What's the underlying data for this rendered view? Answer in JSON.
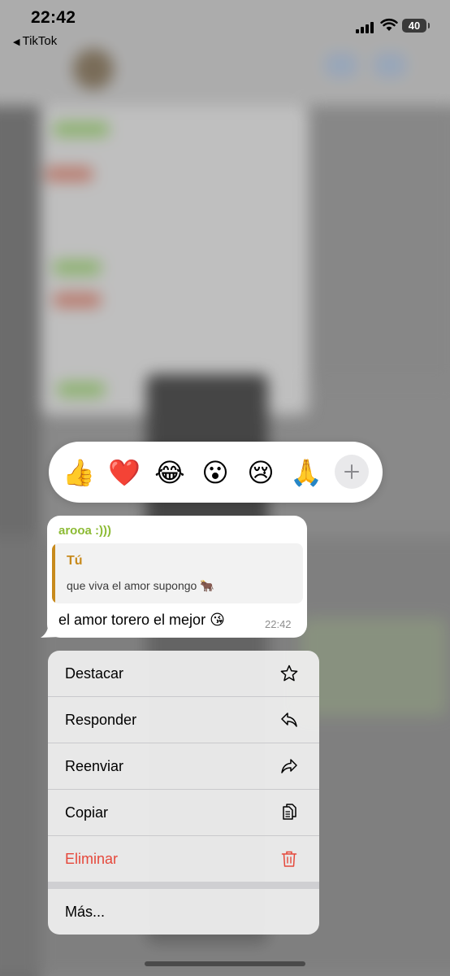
{
  "status_bar": {
    "time": "22:42",
    "back_app": "TikTok",
    "battery": "40"
  },
  "reactions": [
    {
      "emoji": "👍",
      "icon": "thumbs-up-emoji"
    },
    {
      "emoji": "❤️",
      "icon": "red-heart-emoji"
    },
    {
      "emoji": "😂",
      "icon": "tears-of-joy-emoji"
    },
    {
      "emoji": "😮",
      "icon": "surprised-face-emoji"
    },
    {
      "emoji": "😢",
      "icon": "crying-face-emoji"
    },
    {
      "emoji": "🙏",
      "icon": "folded-hands-emoji"
    }
  ],
  "message": {
    "sender": "arooa :)))",
    "quote_author": "Tú",
    "quote_text": "que viva el amor supongo 🐂",
    "text": "el amor torero el mejor 😘",
    "time": "22:42"
  },
  "menu": {
    "items": [
      {
        "label": "Destacar",
        "icon": "star-icon"
      },
      {
        "label": "Responder",
        "icon": "reply-icon"
      },
      {
        "label": "Reenviar",
        "icon": "forward-icon"
      },
      {
        "label": "Copiar",
        "icon": "copy-icon"
      },
      {
        "label": "Eliminar",
        "icon": "trash-icon",
        "color": "#e5483b"
      }
    ],
    "more_label": "Más..."
  },
  "colors": {
    "sender": "#8dbb35",
    "quote_accent": "#c88a1c",
    "danger": "#e5483b"
  }
}
